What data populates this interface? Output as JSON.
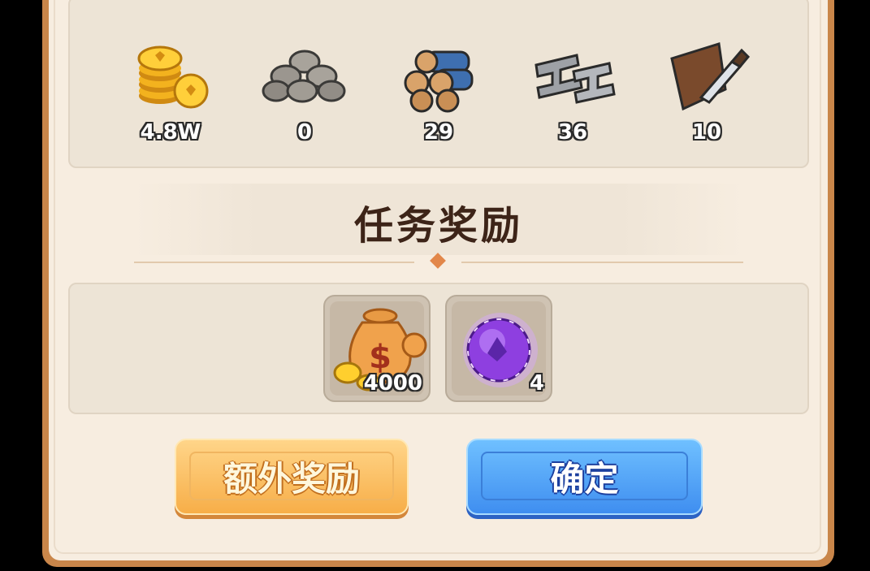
{
  "resources": [
    {
      "icon": "gold-coins-icon",
      "value": "4.8W"
    },
    {
      "icon": "stone-pile-icon",
      "value": "0"
    },
    {
      "icon": "wood-logs-icon",
      "value": "29"
    },
    {
      "icon": "iron-ingot-icon",
      "value": "36"
    },
    {
      "icon": "leather-hide-icon",
      "value": "10"
    }
  ],
  "reward_section": {
    "title": "任务奖励"
  },
  "rewards": [
    {
      "icon": "money-bag-icon",
      "count": "4000"
    },
    {
      "icon": "purple-orb-icon",
      "count": "4"
    }
  ],
  "buttons": {
    "extra_reward": "额外奖励",
    "confirm": "确定"
  },
  "colors": {
    "frame": "#c9864a",
    "panel": "#f7ede0",
    "extra_button": "#f7ae48",
    "confirm_button": "#3f8ef0",
    "title": "#3d2418"
  }
}
